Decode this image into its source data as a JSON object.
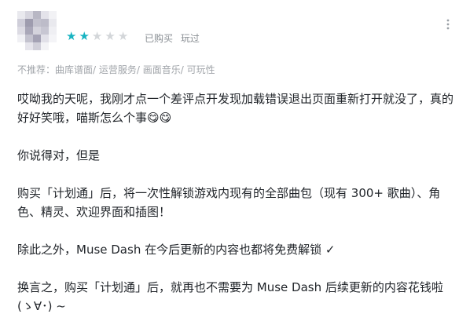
{
  "review": {
    "rating": 2,
    "max_rating": 5,
    "status": "已购买",
    "played": "玩过",
    "more_icon": "more-icon",
    "tags_prefix": "不推荐：",
    "tags": [
      "曲库谱面",
      "运营服务",
      "画面音乐",
      "可玩性"
    ],
    "tag_separator": "/ ",
    "paragraphs": [
      "哎呦我的天呢，我刚才点一个差评点开发现加载错误退出页面重新打开就没了，真的好好笑哦，喵斯怎么个事😋😋",
      "你说得对，但是",
      "购买「计划通」后，将一次性解锁游戏内现有的全部曲包（现有 300+ 歌曲）、角色、精灵、欢迎界面和插图！",
      "除此之外，Muse Dash 在今后更新的内容也都将免费解锁 ✓",
      "换言之，购买「计划通」后，就再也不需要为 Muse Dash 后续更新的内容花钱啦(ゝ∀･) ~"
    ],
    "colors": {
      "star_on": "#17b3c1",
      "star_off": "#d3d6d9"
    }
  }
}
